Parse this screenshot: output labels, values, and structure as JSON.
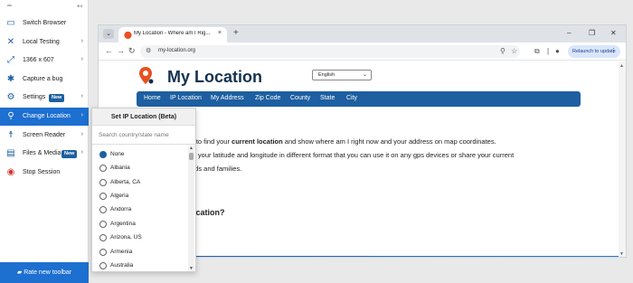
{
  "browser": {
    "tab_title": "My Location - Where am I Rig...",
    "tab_close": "×",
    "new_tab": "+",
    "minimize": "–",
    "maximize": "❐",
    "close": "✕",
    "url": "my-location.org",
    "relaunch_label": "Relaunch to update"
  },
  "page": {
    "site_title": "My Location",
    "language": "English",
    "nav": [
      "Home",
      "IP Location",
      "My Address",
      "Zip Code",
      "County",
      "State",
      "City"
    ],
    "headline_fragment": "n",
    "para_line1_a": "y to find your ",
    "para_line1_b": "current location",
    "para_line1_c": " and show where am I right now and your address on map coordinates.",
    "para_line2": "ip your latitude and longitude in different format that you can use it on any gps devices or share your current",
    "para_line3": "ads and families.",
    "subhead_fragment": "ocation?"
  },
  "sidebar": {
    "items": [
      {
        "label": "Switch Browser",
        "icon": "monitor-icon"
      },
      {
        "label": "Local Testing",
        "icon": "local-testing-icon"
      },
      {
        "label": "1366 x 607",
        "icon": "resolution-icon"
      },
      {
        "label": "Capture a bug",
        "icon": "bug-icon"
      },
      {
        "label": "Settings",
        "icon": "gear-icon",
        "badge": "New"
      },
      {
        "label": "Change Location",
        "icon": "location-pin-icon"
      },
      {
        "label": "Screen Reader",
        "icon": "accessibility-icon"
      },
      {
        "label": "Files & Media",
        "icon": "files-icon",
        "badge": "New"
      },
      {
        "label": "Stop Session",
        "icon": "stop-icon"
      }
    ],
    "rate_button": "Rate new toolbar"
  },
  "location_panel": {
    "title": "Set IP Location (Beta)",
    "search_placeholder": "Search country/state name",
    "options": [
      "None",
      "Albania",
      "Alberta, CA",
      "Algeria",
      "Andorra",
      "Argentina",
      "Arizona, US",
      "Armenia",
      "Australia"
    ],
    "selected": "None"
  },
  "colors": {
    "accent": "#1d6fd0",
    "nav_blue": "#1d5fa0",
    "title_navy": "#14314f",
    "logo_orange": "#e8501f"
  }
}
